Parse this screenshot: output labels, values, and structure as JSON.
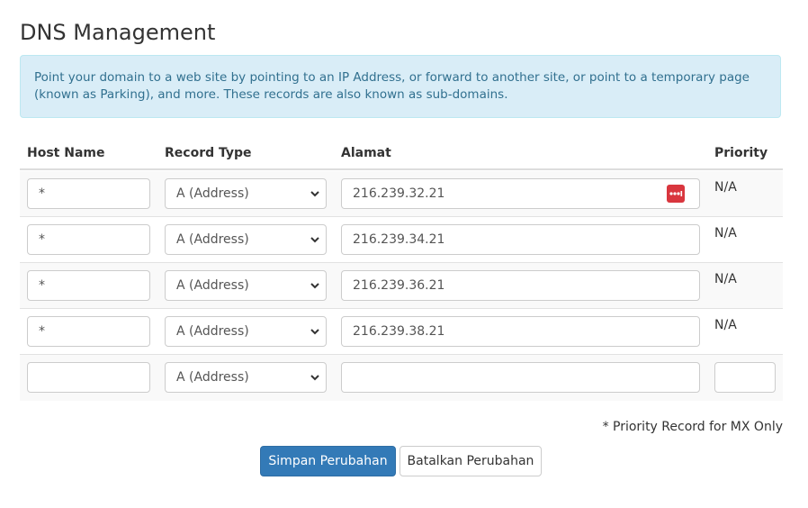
{
  "page": {
    "title": "DNS Management",
    "info": "Point your domain to a web site by pointing to an IP Address, or forward to another site, or point to a temporary page (known as Parking), and more. These records are also known as sub-domains."
  },
  "table": {
    "headers": {
      "host": "Host Name",
      "type": "Record Type",
      "address": "Alamat",
      "priority": "Priority"
    },
    "rows": [
      {
        "host": "*",
        "type": "A (Address)",
        "address": "216.239.32.21",
        "priority": "N/A"
      },
      {
        "host": "*",
        "type": "A (Address)",
        "address": "216.239.34.21",
        "priority": "N/A"
      },
      {
        "host": "*",
        "type": "A (Address)",
        "address": "216.239.36.21",
        "priority": "N/A"
      },
      {
        "host": "*",
        "type": "A (Address)",
        "address": "216.239.38.21",
        "priority": "N/A"
      },
      {
        "host": "",
        "type": "A (Address)",
        "address": "",
        "priority": ""
      }
    ]
  },
  "footnote": "* Priority Record for MX Only",
  "buttons": {
    "save": "Simpan Perubahan",
    "cancel": "Batalkan Perubahan"
  },
  "icons": {
    "password_manager": "password-manager-icon",
    "select_chevron": "chevron-down-icon"
  },
  "colors": {
    "primary": "#337ab7",
    "info_bg": "#d9edf7",
    "info_text": "#31708f",
    "pw_icon": "#d9363e"
  }
}
